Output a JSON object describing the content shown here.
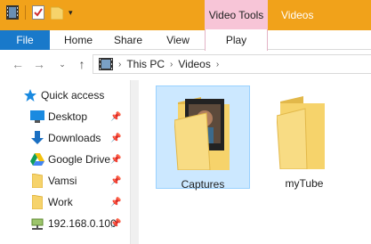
{
  "window": {
    "title": "Videos",
    "context_group": "Video Tools"
  },
  "ribbon": {
    "tabs": [
      "File",
      "Home",
      "Share",
      "View",
      "Play"
    ]
  },
  "address": {
    "crumbs": [
      "This PC",
      "Videos"
    ]
  },
  "nav_pane": {
    "items": [
      {
        "label": "Quick access",
        "icon": "star-icon",
        "pinned": false
      },
      {
        "label": "Desktop",
        "icon": "desktop-icon",
        "pinned": true
      },
      {
        "label": "Downloads",
        "icon": "download-icon",
        "pinned": true
      },
      {
        "label": "Google Drive",
        "icon": "google-drive-icon",
        "pinned": true
      },
      {
        "label": "Vamsi",
        "icon": "folder-icon",
        "pinned": true
      },
      {
        "label": "Work",
        "icon": "folder-icon",
        "pinned": true
      },
      {
        "label": "192.168.0.100",
        "icon": "network-drive-icon",
        "pinned": true
      }
    ]
  },
  "content": {
    "items": [
      {
        "label": "Captures",
        "selected": true,
        "icon": "video-folder-icon"
      },
      {
        "label": "myTube",
        "selected": false,
        "icon": "folder-icon"
      }
    ]
  },
  "colors": {
    "titlebar": "#f1a21a",
    "context_tab": "#f7c5d7",
    "file_tab": "#1979ca",
    "selection": "#cce8ff"
  }
}
